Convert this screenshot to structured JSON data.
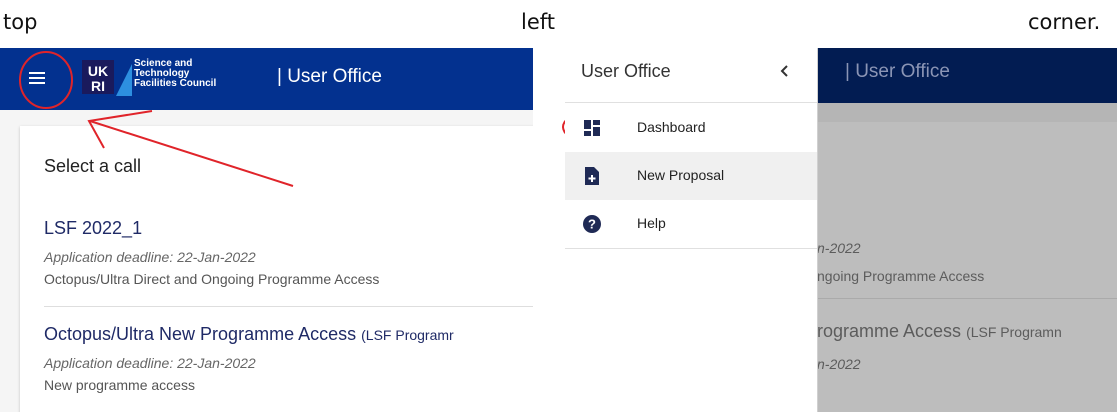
{
  "caption": {
    "top": "top",
    "left": "left",
    "corner": "corner."
  },
  "app": {
    "title": "| User Office",
    "logo_mark": "UKRI",
    "logo_lines": [
      "Science and",
      "Technology",
      "Facilities Council"
    ]
  },
  "icons": {
    "menu": "hamburger-menu-icon",
    "close": "chevron-left-icon",
    "dashboard": "dashboard-icon",
    "new_proposal": "note-add-icon",
    "help": "help-circle-icon"
  },
  "colors": {
    "appbar": "#03318f",
    "annotation": "#e0242a"
  },
  "left": {
    "card_title": "Select a call",
    "calls": [
      {
        "name": "LSF 2022_1",
        "extra": "",
        "deadline": "Application deadline: 22-Jan-2022",
        "description": "Octopus/Ultra Direct and Ongoing Programme Access"
      },
      {
        "name": "Octopus/Ultra New Programme Access",
        "extra": "(LSF Programr",
        "deadline": "Application deadline: 22-Jan-2022",
        "description": "New programme access"
      }
    ]
  },
  "drawer": {
    "title": "User Office",
    "items": [
      {
        "label": "Dashboard"
      },
      {
        "label": "New Proposal"
      },
      {
        "label": "Help"
      }
    ]
  },
  "backdrop": {
    "title": "| User Office",
    "deadline_1": "n-2022",
    "desc_1": "ngoing Programme Access",
    "name_2": "rogramme Access",
    "extra_2": "(LSF Programn",
    "deadline_2": "n-2022"
  }
}
